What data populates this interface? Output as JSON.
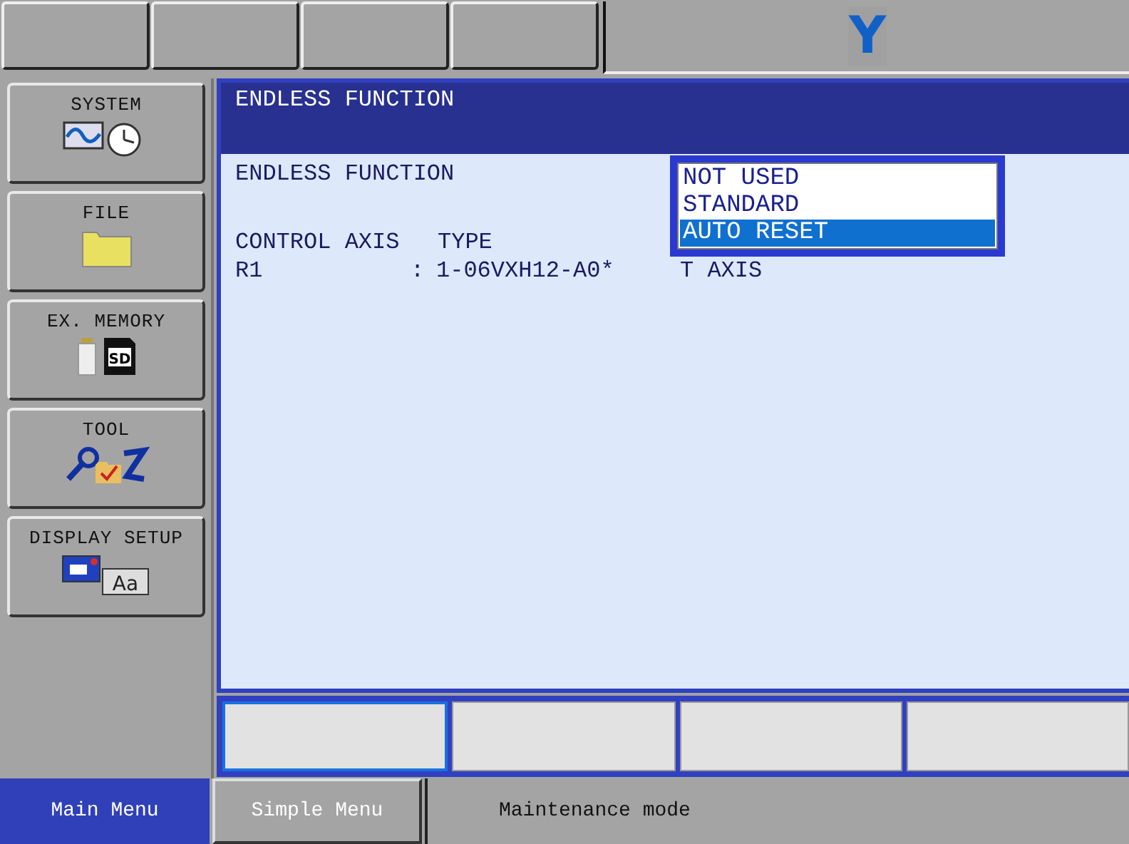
{
  "top_bar": {
    "logo": "Y"
  },
  "sidebar": {
    "items": [
      {
        "label": "SYSTEM",
        "kind": "system"
      },
      {
        "label": "FILE",
        "kind": "file"
      },
      {
        "label": "EX. MEMORY",
        "kind": "memory",
        "icon_text": "SD"
      },
      {
        "label": "TOOL",
        "kind": "tool"
      },
      {
        "label": "DISPLAY SETUP",
        "kind": "display",
        "icon_text": "Aa"
      }
    ]
  },
  "panel": {
    "title": "ENDLESS FUNCTION",
    "setting_label": "ENDLESS FUNCTION",
    "columns": [
      "CONTROL AXIS",
      "TYPE"
    ],
    "rows": [
      {
        "axis": "R1",
        "separator": ":",
        "type": "1-06VXH12-A0*",
        "value": "T AXIS"
      }
    ],
    "dropdown": {
      "options": [
        {
          "label": "NOT USED",
          "selected": false
        },
        {
          "label": "STANDARD",
          "selected": false
        },
        {
          "label": "AUTO RESET",
          "selected": true
        }
      ]
    }
  },
  "function_keys": [
    {
      "selected": true
    },
    {
      "selected": false
    },
    {
      "selected": false
    },
    {
      "selected": false
    }
  ],
  "bottom_bar": {
    "tabs": [
      {
        "label": "Main Menu",
        "selected": true
      },
      {
        "label": "Simple Menu",
        "selected": false
      }
    ],
    "status": "Maintenance mode"
  }
}
